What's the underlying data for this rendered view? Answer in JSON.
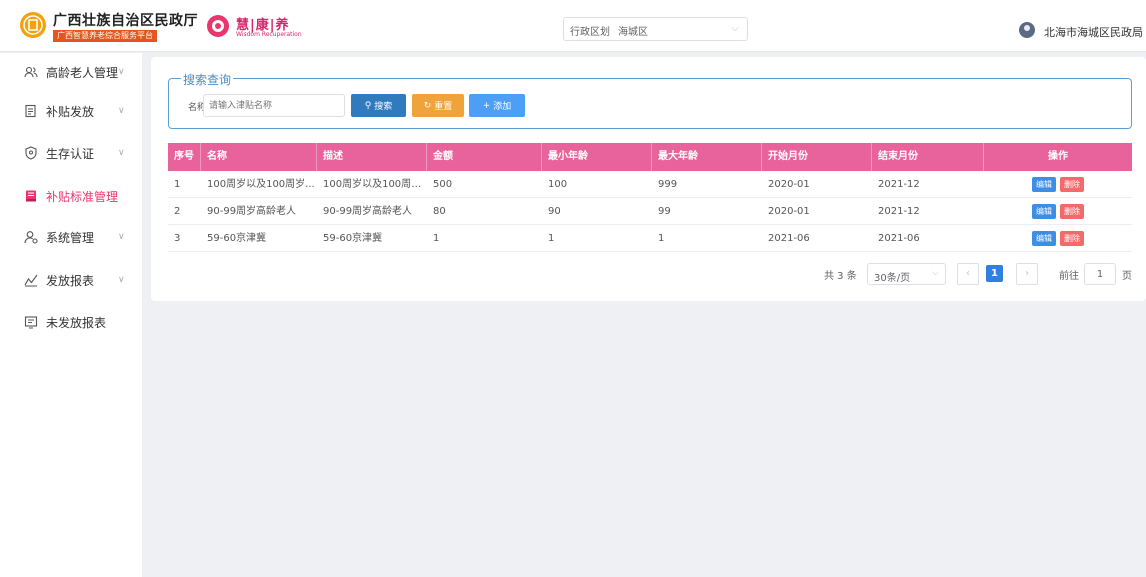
{
  "header": {
    "org_name": "广西壮族自治区民政厅",
    "org_subtitle": "广西智慧养老综合服务平台",
    "partner_cn": "慧|康|养",
    "partner_en": "Wisdom Recuperation",
    "region_label": "行政区划",
    "region_value": "海城区",
    "user_name": "北海市海城区民政局"
  },
  "sidebar": {
    "items": [
      {
        "label": "高龄老人管理",
        "icon": "users-icon",
        "has_chevron": true
      },
      {
        "label": "补贴发放",
        "icon": "document-icon",
        "has_chevron": true
      },
      {
        "label": "生存认证",
        "icon": "shield-icon",
        "has_chevron": true
      },
      {
        "label": "补贴标准管理",
        "icon": "book-icon",
        "has_chevron": false,
        "active": true
      },
      {
        "label": "系统管理",
        "icon": "user-settings-icon",
        "has_chevron": true
      },
      {
        "label": "发放报表",
        "icon": "chart-icon",
        "has_chevron": true
      },
      {
        "label": "未发放报表",
        "icon": "report-icon",
        "has_chevron": false
      }
    ],
    "active_color": "#e8376d"
  },
  "search": {
    "legend": "搜索查询",
    "name_label": "名称",
    "name_placeholder": "请输入津贴名称",
    "search_label": "搜索",
    "reset_label": "重置",
    "add_label": "添加"
  },
  "table": {
    "headers": [
      "序号",
      "名称",
      "描述",
      "金额",
      "最小年龄",
      "最大年龄",
      "开始月份",
      "结束月份",
      "操作"
    ],
    "header_color": "#e8639b",
    "rows": [
      [
        "1",
        "100周岁以及100周岁...",
        "100周岁以及100周岁...",
        "500",
        "100",
        "999",
        "2020-01",
        "2021-12"
      ],
      [
        "2",
        "90-99周岁高龄老人",
        "90-99周岁高龄老人",
        "80",
        "90",
        "99",
        "2020-01",
        "2021-12"
      ],
      [
        "3",
        "59-60京津冀",
        "59-60京津冀",
        "1",
        "1",
        "1",
        "2021-06",
        "2021-06"
      ]
    ],
    "edit_label": "编辑",
    "delete_label": "删除"
  },
  "pagination": {
    "total": "共 3 条",
    "page_size": "30条/页",
    "current_page": "1",
    "goto_label": "前往",
    "goto_value": "1",
    "page_suffix": "页"
  }
}
